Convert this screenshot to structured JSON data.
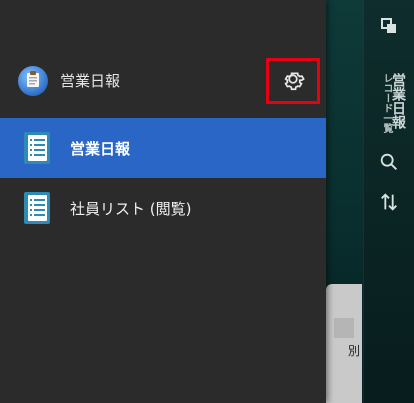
{
  "background": {
    "right_rail": {
      "title_main": "営業日報",
      "title_sub": "レコード一覧"
    },
    "card": {
      "text": "別"
    }
  },
  "drawer": {
    "header": {
      "app_name": "営業日報"
    },
    "items": [
      {
        "label": "営業日報",
        "active": true
      },
      {
        "label": "社員リスト (閲覧)",
        "active": false
      }
    ]
  },
  "colors": {
    "accent": "#2A66C6",
    "highlight": "#E60012",
    "drawer_bg": "#2B2B2B"
  },
  "icons": [
    "copy-icon",
    "search-icon",
    "sort-icon",
    "gear-icon",
    "document-list-icon",
    "clipboard-icon"
  ]
}
